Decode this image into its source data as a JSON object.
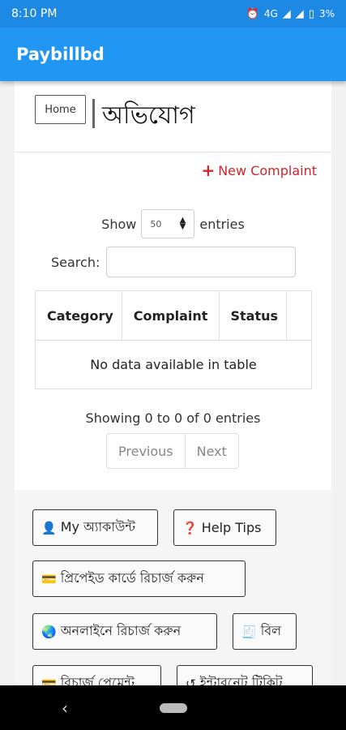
{
  "status_bar": {
    "time": "8:10 PM",
    "battery": "3%",
    "network": "4G"
  },
  "app": {
    "title": "Paybillbd"
  },
  "header": {
    "home_label": "Home",
    "title": "অভিযোগ"
  },
  "actions": {
    "new_complaint": "New Complaint"
  },
  "table_controls": {
    "show_label": "Show",
    "entries_value": "50",
    "entries_label": "entries",
    "search_label": "Search:",
    "search_value": ""
  },
  "table": {
    "columns": [
      "Category",
      "Complaint",
      "Status",
      ""
    ],
    "empty_message": "No data available in table"
  },
  "pagination": {
    "info": "Showing 0 to 0 of 0 entries",
    "previous": "Previous",
    "next": "Next"
  },
  "buttons": {
    "my_account": "My অ্যাকাউন্ট",
    "help_tips": "Help Tips",
    "prepaid_recharge": "প্রিপেইড কার্ডে রিচার্জ করুন",
    "online_recharge": "অনলাইনে রিচার্জ করুন",
    "bill": "বিল",
    "recharge_payment": "রিচার্জ পেমেন্ট",
    "internet_ticket": "ইন্টারনেট টিকিট"
  },
  "colors": {
    "app_bar": "#2196f3",
    "status_bar": "#1e88e5",
    "danger": "#d0262d"
  }
}
